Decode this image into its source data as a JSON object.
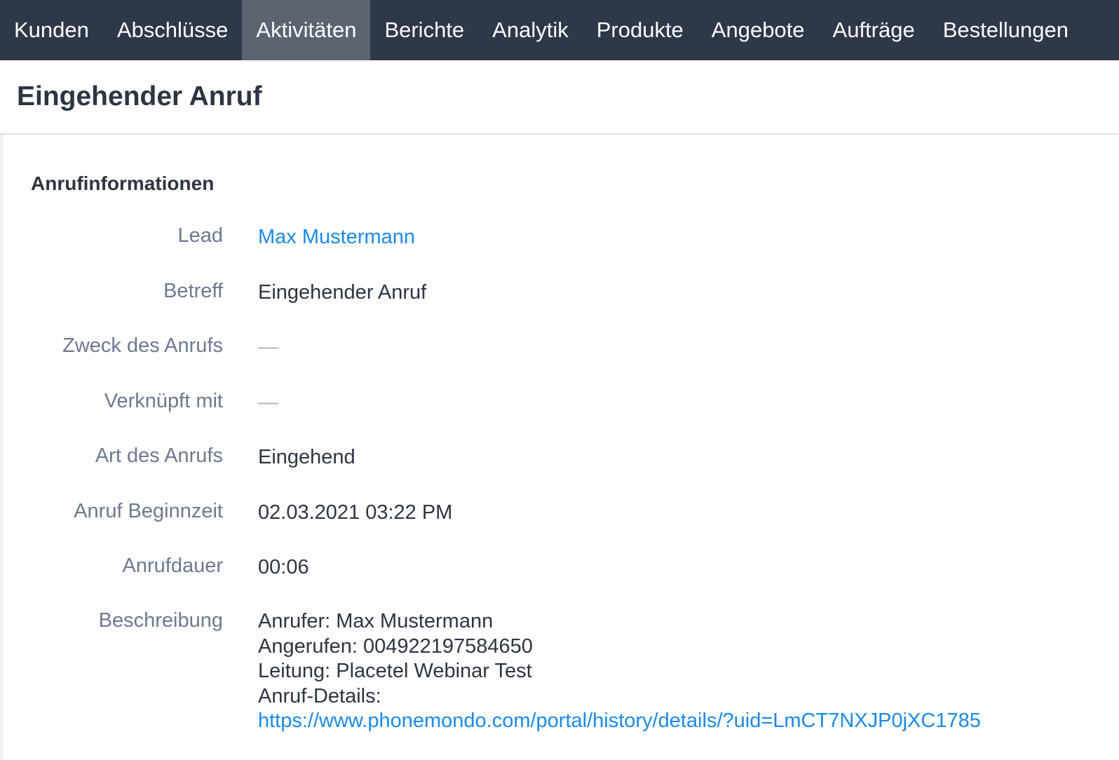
{
  "nav": {
    "items": [
      "Kunden",
      "Abschlüsse",
      "Aktivitäten",
      "Berichte",
      "Analytik",
      "Produkte",
      "Angebote",
      "Aufträge",
      "Bestellungen"
    ],
    "active_item": "Aktivitäten"
  },
  "header": {
    "title": "Eingehender Anruf"
  },
  "section": {
    "title": "Anrufinformationen"
  },
  "fields": {
    "lead": {
      "label": "Lead",
      "value": "Max Mustermann"
    },
    "betreff": {
      "label": "Betreff",
      "value": "Eingehender Anruf"
    },
    "zweck": {
      "label": "Zweck des Anrufs",
      "value": "—"
    },
    "verknuepft": {
      "label": "Verknüpft mit",
      "value": "—"
    },
    "art": {
      "label": "Art des Anrufs",
      "value": "Eingehend"
    },
    "beginn": {
      "label": "Anruf Beginnzeit",
      "value": "02.03.2021 03:22 PM"
    },
    "dauer": {
      "label": "Anrufdauer",
      "value": "00:06"
    },
    "beschreibung": {
      "label": "Beschreibung",
      "lines": [
        "Anrufer: Max Mustermann",
        "Angerufen: 004922197584650",
        "Leitung: Placetel Webinar Test",
        "Anruf-Details:"
      ],
      "link": "https://www.phonemondo.com/portal/history/details/?uid=LmCT7NXJP0jXC1785"
    }
  },
  "colors": {
    "nav_bg": "#2e3848",
    "nav_active": "#5b6470",
    "link": "#1a8ae8",
    "label": "#6b7a90",
    "text": "#2c3544"
  }
}
